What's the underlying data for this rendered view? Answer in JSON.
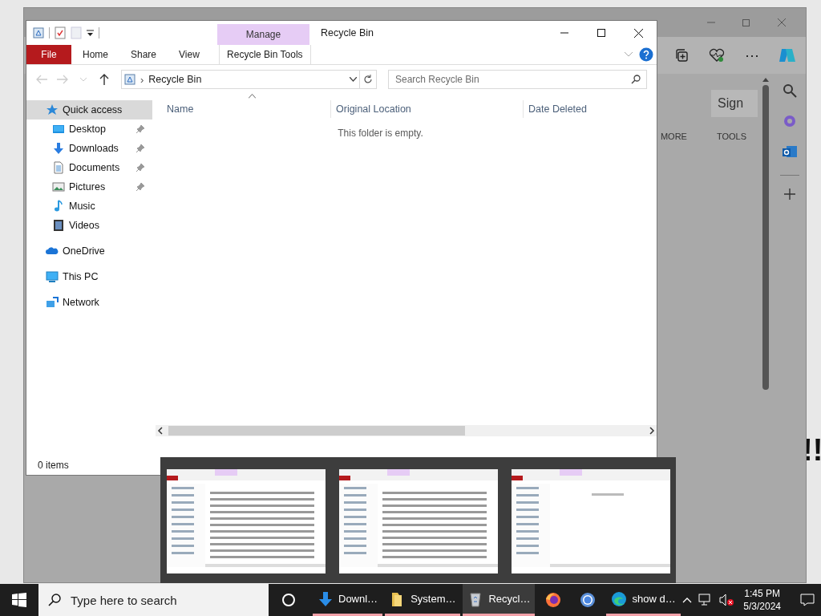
{
  "browser": {
    "sign_button": "Sign",
    "nav_links": [
      "MORE",
      "TOOLS"
    ],
    "more_button": "⋯"
  },
  "background_text": "!!",
  "explorer": {
    "title": "Recycle Bin",
    "contextual_tab": {
      "label": "Manage",
      "tool_tab": "Recycle Bin Tools"
    },
    "ribbon_tabs": [
      {
        "label": "File",
        "kind": "file"
      },
      {
        "label": "Home",
        "kind": "tab"
      },
      {
        "label": "Share",
        "kind": "tab"
      },
      {
        "label": "View",
        "kind": "tab"
      }
    ],
    "address": {
      "path": "Recycle Bin",
      "separator": "›"
    },
    "search": {
      "placeholder": "Search Recycle Bin"
    },
    "navigation": [
      {
        "label": "Quick access",
        "kind": "star",
        "selected": true,
        "children": [
          {
            "label": "Desktop",
            "kind": "desktop",
            "pinned": true,
            "selected": false
          },
          {
            "label": "Downloads",
            "kind": "download",
            "pinned": true,
            "selected": false
          },
          {
            "label": "Documents",
            "kind": "document",
            "pinned": true,
            "selected": false
          },
          {
            "label": "Pictures",
            "kind": "picture",
            "pinned": true,
            "selected": false
          },
          {
            "label": "Music",
            "kind": "music",
            "pinned": false,
            "selected": false
          },
          {
            "label": "Videos",
            "kind": "video",
            "pinned": false,
            "selected": false
          }
        ]
      },
      {
        "label": "OneDrive",
        "kind": "cloud",
        "selected": false
      },
      {
        "label": "This PC",
        "kind": "pc",
        "selected": false
      },
      {
        "label": "Network",
        "kind": "network",
        "selected": false
      }
    ],
    "columns": [
      {
        "label": "Name",
        "sorted": true
      },
      {
        "label": "Original Location",
        "sorted": false
      },
      {
        "label": "Date Deleted",
        "sorted": false
      }
    ],
    "empty_message": "This folder is empty.",
    "status": "0 items"
  },
  "thumbnails": [
    {
      "kind": "file-list"
    },
    {
      "kind": "file-list"
    },
    {
      "kind": "empty-folder"
    }
  ],
  "taskbar": {
    "search_placeholder": "Type here to search",
    "apps": [
      {
        "kind": "download",
        "label": "Downl…",
        "running": true,
        "selected": false
      },
      {
        "kind": "folder",
        "label": "System…",
        "running": true,
        "selected": false
      },
      {
        "kind": "recycle-bin",
        "label": "Recycl…",
        "running": true,
        "selected": true
      },
      {
        "kind": "firefox",
        "running": false,
        "selected": false
      },
      {
        "kind": "chrome",
        "running": false,
        "selected": false
      },
      {
        "kind": "edge",
        "label": "show d…",
        "running": true,
        "selected": false
      }
    ],
    "time": "1:45 PM",
    "date": "5/3/2024"
  }
}
